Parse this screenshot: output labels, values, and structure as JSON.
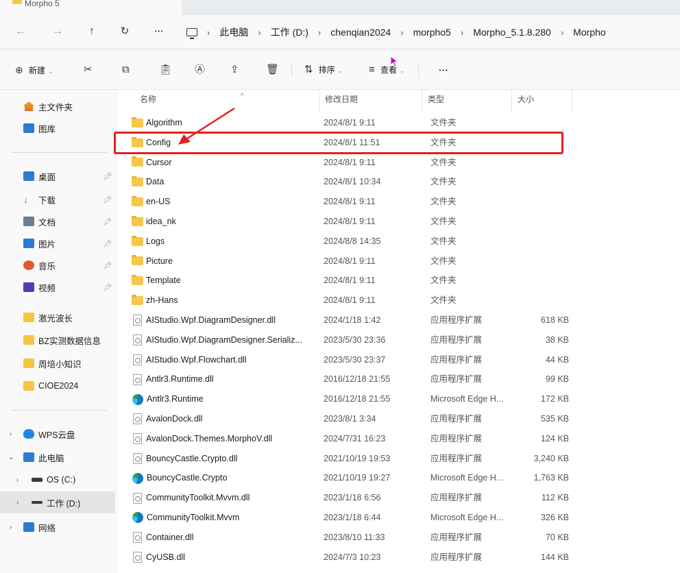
{
  "tab": {
    "title": "Morpho 5"
  },
  "breadcrumb": [
    "此电脑",
    "工作 (D:)",
    "chenqian2024",
    "morpho5",
    "Morpho_5.1.8.280",
    "Morpho"
  ],
  "toolbar": {
    "new_label": "新建",
    "sort_label": "排序",
    "view_label": "查看",
    "more_label": "···"
  },
  "sidebar": {
    "home": "主文件夹",
    "gallery": "图库",
    "quick": [
      {
        "label": "桌面",
        "icon": "desktop-icon",
        "color": "#2b7cd3"
      },
      {
        "label": "下载",
        "icon": "download-icon",
        "color": "#2b7cd3"
      },
      {
        "label": "文档",
        "icon": "document-icon",
        "color": "#6f7c91"
      },
      {
        "label": "图片",
        "icon": "pictures-icon",
        "color": "#2b7cd3"
      },
      {
        "label": "音乐",
        "icon": "music-icon",
        "color": "#e05a2b"
      },
      {
        "label": "视频",
        "icon": "video-icon",
        "color": "#4a3fb6"
      }
    ],
    "folders": [
      "激光波长",
      "BZ实测数据信息",
      "周培小知识",
      "CIOE2024"
    ],
    "wps": "WPS云盘",
    "pc": "此电脑",
    "drive_c": "OS (C:)",
    "drive_d": "工作 (D:)",
    "network": "网络"
  },
  "columns": {
    "name": "名称",
    "date": "修改日期",
    "type": "类型",
    "size": "大小"
  },
  "files": [
    {
      "name": "Algorithm",
      "date": "2024/8/1 9:11",
      "type": "文件夹",
      "size": "",
      "kind": "folder"
    },
    {
      "name": "Config",
      "date": "2024/8/1 11:51",
      "type": "文件夹",
      "size": "",
      "kind": "folder"
    },
    {
      "name": "Cursor",
      "date": "2024/8/1 9:11",
      "type": "文件夹",
      "size": "",
      "kind": "folder"
    },
    {
      "name": "Data",
      "date": "2024/8/1 10:34",
      "type": "文件夹",
      "size": "",
      "kind": "folder"
    },
    {
      "name": "en-US",
      "date": "2024/8/1 9:11",
      "type": "文件夹",
      "size": "",
      "kind": "folder"
    },
    {
      "name": "idea_nk",
      "date": "2024/8/1 9:11",
      "type": "文件夹",
      "size": "",
      "kind": "folder"
    },
    {
      "name": "Logs",
      "date": "2024/8/8 14:35",
      "type": "文件夹",
      "size": "",
      "kind": "folder"
    },
    {
      "name": "Picture",
      "date": "2024/8/1 9:11",
      "type": "文件夹",
      "size": "",
      "kind": "folder"
    },
    {
      "name": "Template",
      "date": "2024/8/1 9:11",
      "type": "文件夹",
      "size": "",
      "kind": "folder"
    },
    {
      "name": "zh-Hans",
      "date": "2024/8/1 9:11",
      "type": "文件夹",
      "size": "",
      "kind": "folder"
    },
    {
      "name": "AIStudio.Wpf.DiagramDesigner.dll",
      "date": "2024/1/18 1:42",
      "type": "应用程序扩展",
      "size": "618 KB",
      "kind": "dll"
    },
    {
      "name": "AIStudio.Wpf.DiagramDesigner.Serializ...",
      "date": "2023/5/30 23:36",
      "type": "应用程序扩展",
      "size": "38 KB",
      "kind": "dll"
    },
    {
      "name": "AIStudio.Wpf.Flowchart.dll",
      "date": "2023/5/30 23:37",
      "type": "应用程序扩展",
      "size": "44 KB",
      "kind": "dll"
    },
    {
      "name": "Antlr3.Runtime.dll",
      "date": "2016/12/18 21:55",
      "type": "应用程序扩展",
      "size": "99 KB",
      "kind": "dll"
    },
    {
      "name": "Antlr3.Runtime",
      "date": "2016/12/18 21:55",
      "type": "Microsoft Edge H...",
      "size": "172 KB",
      "kind": "edge"
    },
    {
      "name": "AvalonDock.dll",
      "date": "2023/8/1 3:34",
      "type": "应用程序扩展",
      "size": "535 KB",
      "kind": "dll"
    },
    {
      "name": "AvalonDock.Themes.MorphoV.dll",
      "date": "2024/7/31 16:23",
      "type": "应用程序扩展",
      "size": "124 KB",
      "kind": "dll"
    },
    {
      "name": "BouncyCastle.Crypto.dll",
      "date": "2021/10/19 19:53",
      "type": "应用程序扩展",
      "size": "3,240 KB",
      "kind": "dll"
    },
    {
      "name": "BouncyCastle.Crypto",
      "date": "2021/10/19 19:27",
      "type": "Microsoft Edge H...",
      "size": "1,763 KB",
      "kind": "edge"
    },
    {
      "name": "CommunityToolkit.Mvvm.dll",
      "date": "2023/1/18 6:56",
      "type": "应用程序扩展",
      "size": "112 KB",
      "kind": "dll"
    },
    {
      "name": "CommunityToolkit.Mvvm",
      "date": "2023/1/18 6:44",
      "type": "Microsoft Edge H...",
      "size": "326 KB",
      "kind": "edge"
    },
    {
      "name": "Container.dll",
      "date": "2023/8/10 11:33",
      "type": "应用程序扩展",
      "size": "70 KB",
      "kind": "dll"
    },
    {
      "name": "CyUSB.dll",
      "date": "2024/7/3 10:23",
      "type": "应用程序扩展",
      "size": "144 KB",
      "kind": "dll"
    }
  ]
}
